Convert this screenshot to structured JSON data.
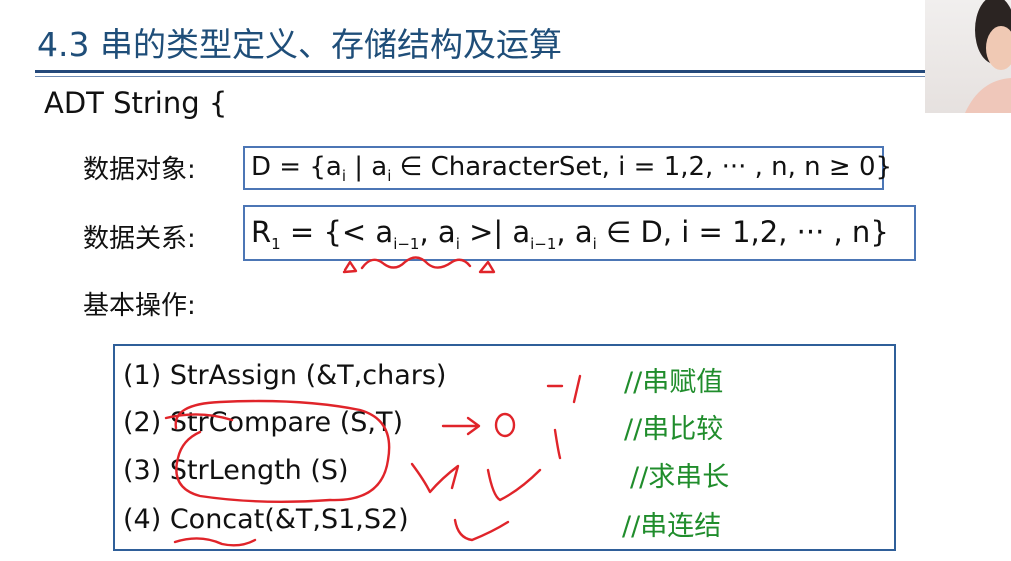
{
  "slide": {
    "title": "4.3 串的类型定义、存储结构及运算",
    "adt_header": "ADT String {"
  },
  "data_object": {
    "label": "数据对象:",
    "formula_main": "D = {a",
    "sub1": "i",
    "formula_mid": " | a",
    "sub2": "i",
    "formula_tail": " ∈ CharacterSet, i = 1,2, ··· , n,  n ≥ 0}"
  },
  "data_relation": {
    "label": "数据关系:",
    "r": "R",
    "r_sub": "1",
    "part1": " = {< a",
    "sub_a": "i−1",
    "part2": ", a",
    "sub_b": "i",
    "part3": " >| a",
    "sub_c": "i−1",
    "part4": ", a",
    "sub_d": "i",
    "part5": " ∈ D, i = 1,2, ··· , n}"
  },
  "basic_ops_label": "基本操作:",
  "operations": [
    {
      "signature": "(1)  StrAssign (&T,chars)",
      "comment": "//串赋值"
    },
    {
      "signature": "(2) StrCompare (S,T)",
      "comment": "//串比较"
    },
    {
      "signature": "(3) StrLength (S)",
      "comment": "//求串长"
    },
    {
      "signature": "(4) Concat(&T,S1,S2)",
      "comment": "//串连结"
    }
  ],
  "colors": {
    "title": "#1f4e79",
    "box_border": "#4c76b5",
    "comment": "#208d2c",
    "ink": "#e0242a"
  }
}
